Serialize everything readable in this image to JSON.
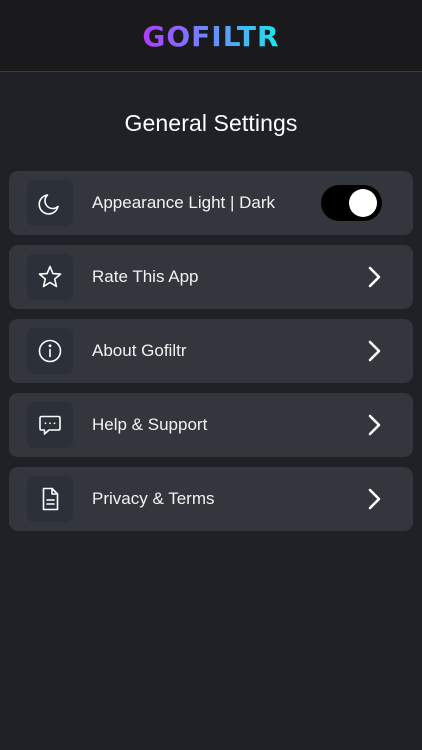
{
  "header": {
    "logo_text": "GOFILTR",
    "colors": {
      "gradient_start": "#b23bff",
      "gradient_mid": "#6a8bff",
      "gradient_end": "#19e8ea"
    }
  },
  "page": {
    "title": "General Settings"
  },
  "settings": {
    "items": [
      {
        "label": "Appearance Light | Dark",
        "icon": "moon-icon",
        "control": "toggle",
        "toggle_state": "on"
      },
      {
        "label": "Rate This App",
        "icon": "star-icon",
        "control": "chevron"
      },
      {
        "label": "About Gofiltr",
        "icon": "info-icon",
        "control": "chevron"
      },
      {
        "label": "Help & Support",
        "icon": "chat-bubble-icon",
        "control": "chevron"
      },
      {
        "label": "Privacy & Terms",
        "icon": "document-icon",
        "control": "chevron"
      }
    ]
  },
  "colors": {
    "background": "#1f2127",
    "header_background": "#1a1a1c",
    "card_background": "#34363d",
    "icon_box_background": "#2b3039",
    "text": "#ffffff",
    "toggle_track": "#000000",
    "toggle_knob": "#ffffff"
  }
}
